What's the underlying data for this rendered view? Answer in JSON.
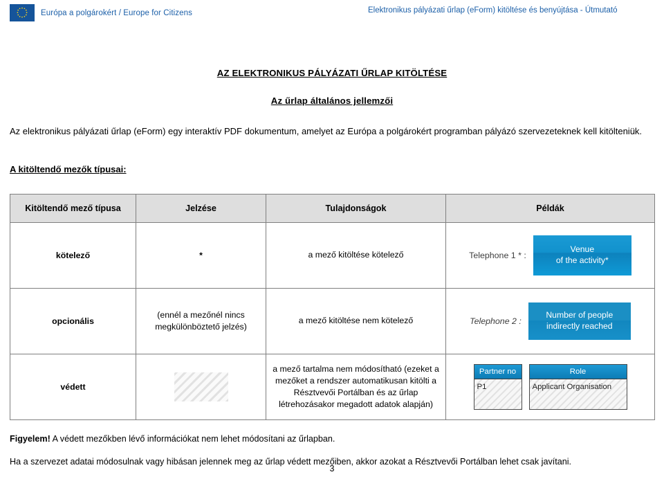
{
  "header": {
    "left_text": "Európa a polgárokért / Europe for Citizens",
    "logo_name": "eu-flag-logo",
    "right_text": "Elektronikus pályázati űrlap (eForm) kitöltése és benyújtása - Útmutató",
    "accent_color": "#1b5fa8"
  },
  "document": {
    "title": "AZ ELEKTRONIKUS PÁLYÁZATI ŰRLAP KITÖLTÉSE",
    "subtitle": "Az űrlap általános jellemzői",
    "intro": "Az elektronikus pályázati űrlap (eForm) egy interaktív PDF dokumentum, amelyet az Európa a polgárokért programban pályázó szervezeteknek kell kitölteniük.",
    "section_label": "A kitöltendő mezők típusai:"
  },
  "table": {
    "headers": [
      "Kitöltendő mező típusa",
      "Jelzése",
      "Tulajdonságok",
      "Példák"
    ],
    "rows": [
      {
        "type": "kötelező",
        "mark": "*",
        "mark_kind": "asterisk",
        "properties": "a mező kitöltése kötelező",
        "example_label": "Telephone 1 * :",
        "example_label_italic": false,
        "example_box": "Venue\nof the activity*",
        "example_box_line1": "Venue",
        "example_box_line2": "of the activity*"
      },
      {
        "type": "opcionális",
        "mark": "(ennél a mezőnél nincs megkülönböztető jelzés)",
        "mark_kind": "text",
        "properties": "a mező kitöltése nem kötelező",
        "example_label": "Telephone 2 :",
        "example_label_italic": true,
        "example_box_line1": "Number  of people",
        "example_box_line2": "indirectly reached"
      },
      {
        "type": "védett",
        "mark": "",
        "mark_kind": "hatch",
        "properties": "a mező tartalma nem módosítható (ezeket a mezőket a rendszer automatikusan kitölti a Résztvevői Portálban és az űrlap létrehozásakor megadott adatok alapján)",
        "field_pairs": [
          {
            "head": "Partner no",
            "body": "P1"
          },
          {
            "head": "Role",
            "body": "Applicant Organisation"
          }
        ]
      }
    ]
  },
  "notes": {
    "warning_prefix": "Figyelem!",
    "warning_text": " A védett mezőkben lévő információkat nem lehet módosítani az űrlapban.",
    "second_note": "Ha a szervezet adatai módosulnak vagy hibásan jelennek meg az űrlap védett mezőiben, akkor azokat a Résztvevői Portálban lehet csak javítani."
  },
  "footer": {
    "page_number": "3"
  }
}
